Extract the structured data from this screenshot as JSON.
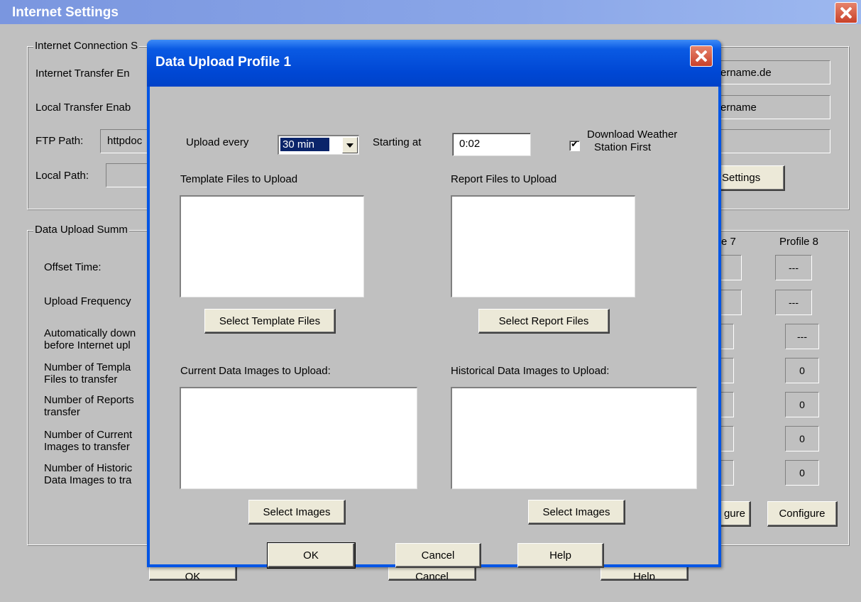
{
  "outer": {
    "title": "Internet Settings",
    "connection_group": "Internet Connection S",
    "internet_transfer": "Internet Transfer En",
    "local_transfer": "Local Transfer Enab",
    "ftp_path_label": "FTP Path:",
    "ftp_path_value": "httpdoc",
    "local_path_label": "Local Path:",
    "host_value": "ername.de",
    "user_value": "ername",
    "settings_button": "Settings",
    "summary_group": "Data Upload Summ",
    "profile7_header": "e 7",
    "profile8_header": "Profile 8",
    "rows": {
      "offset_time": "Offset Time:",
      "upload_frequency": "Upload Frequency",
      "auto_download_1": "Automatically down",
      "auto_download_2": "before Internet upl",
      "num_template_1": "Number of Templa",
      "num_template_2": "Files to transfer",
      "num_reports_1": "Number of Reports",
      "num_reports_2": "transfer",
      "num_current_1": "Number of Current",
      "num_current_2": "Images to transfer",
      "num_historic_1": "Number of Historic",
      "num_historic_2": "Data Images to tra"
    },
    "profile8_values": {
      "offset": "---",
      "frequency": "---",
      "auto_download": "---",
      "templates": "0",
      "reports": "0",
      "current": "0",
      "historic": "0"
    },
    "configure7": "gure",
    "configure8": "Configure",
    "ok": "OK",
    "cancel": "Cancel",
    "help": "Help"
  },
  "dialog": {
    "title": "Data Upload Profile 1",
    "upload_every_label": "Upload every",
    "upload_every_value": "30 min",
    "starting_at_label": "Starting at",
    "starting_at_value": "0:02",
    "download_first_line1": "Download Weather",
    "download_first_line2": "Station First",
    "download_first_checked": true,
    "template_files_label": "Template Files to Upload",
    "report_files_label": "Report Files to Upload",
    "select_template_button": "Select Template Files",
    "select_report_button": "Select Report Files",
    "current_images_label": "Current Data Images to Upload:",
    "historical_images_label": "Historical Data Images to Upload:",
    "select_images_current": "Select Images",
    "select_images_historical": "Select Images",
    "ok": "OK",
    "cancel": "Cancel",
    "help": "Help"
  },
  "colors": {
    "window_bg": "#c0c0c0",
    "outer_titlebar": "#7a96df",
    "dialog_titlebar": "#0047d4",
    "close_button": "#c8412a",
    "selection": "#0a246a"
  }
}
